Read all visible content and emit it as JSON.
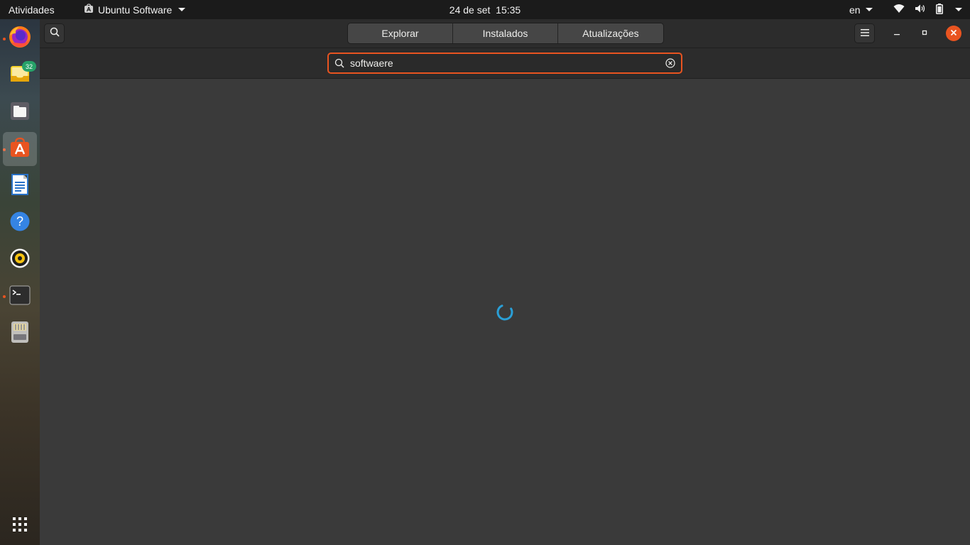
{
  "topbar": {
    "activities": "Atividades",
    "app_name": "Ubuntu Software",
    "date": "24 de set",
    "time": "15:35",
    "language": "en"
  },
  "dock": {
    "items": [
      {
        "name": "firefox",
        "running": true
      },
      {
        "name": "mail",
        "badge": "32"
      },
      {
        "name": "files"
      },
      {
        "name": "ubuntu-software",
        "running": true,
        "active": true
      },
      {
        "name": "libreoffice-writer"
      },
      {
        "name": "help"
      },
      {
        "name": "rhythmbox"
      },
      {
        "name": "terminal",
        "running": true
      },
      {
        "name": "disk"
      },
      {
        "name": "show-applications"
      }
    ]
  },
  "window": {
    "tabs": [
      {
        "label": "Explorar"
      },
      {
        "label": "Instalados"
      },
      {
        "label": "Atualizações"
      }
    ],
    "search": {
      "value": "softwaere"
    },
    "colors": {
      "accent": "#e95420",
      "spinner": "#2a9fd6",
      "background": "#3a3a3a",
      "header": "#2c2c2c"
    }
  }
}
